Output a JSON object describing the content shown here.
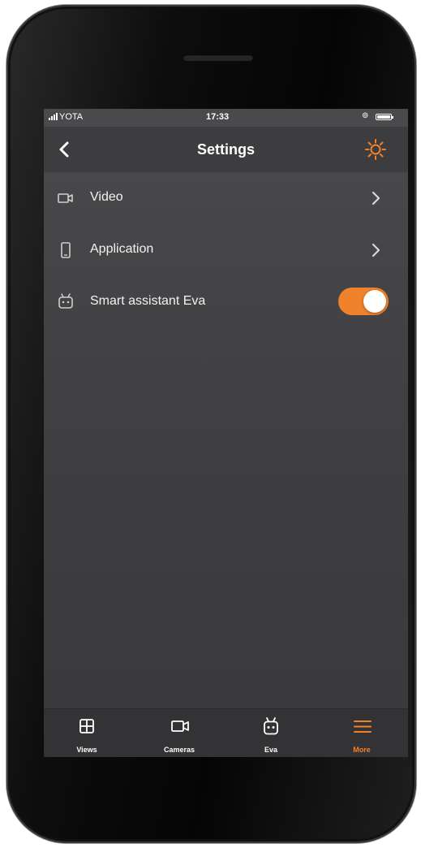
{
  "colors": {
    "accent": "#f0822b",
    "screen_bg": "#444446",
    "navbar_bg": "#3d3d3f",
    "tabbar_bg": "#333335",
    "text": "#ffffff"
  },
  "status_bar": {
    "carrier": "YOTA",
    "time": "17:33",
    "orientation_lock_icon": "orientation-lock-icon",
    "battery_icon": "battery-icon"
  },
  "header": {
    "title": "Settings",
    "back_icon": "chevron-left-icon",
    "right_icon": "sun-icon"
  },
  "settings": {
    "items": [
      {
        "label": "Video",
        "icon": "video-camera-icon",
        "control": "chevron"
      },
      {
        "label": "Application",
        "icon": "phone-icon",
        "control": "chevron"
      },
      {
        "label": "Smart assistant Eva",
        "icon": "robot-icon",
        "control": "toggle",
        "enabled": true
      }
    ]
  },
  "tab_bar": {
    "tabs": [
      {
        "label": "Views",
        "icon": "grid-icon",
        "active": false
      },
      {
        "label": "Cameras",
        "icon": "video-camera-icon",
        "active": false
      },
      {
        "label": "Eva",
        "icon": "robot-icon",
        "active": false
      },
      {
        "label": "More",
        "icon": "menu-icon",
        "active": true
      }
    ]
  }
}
